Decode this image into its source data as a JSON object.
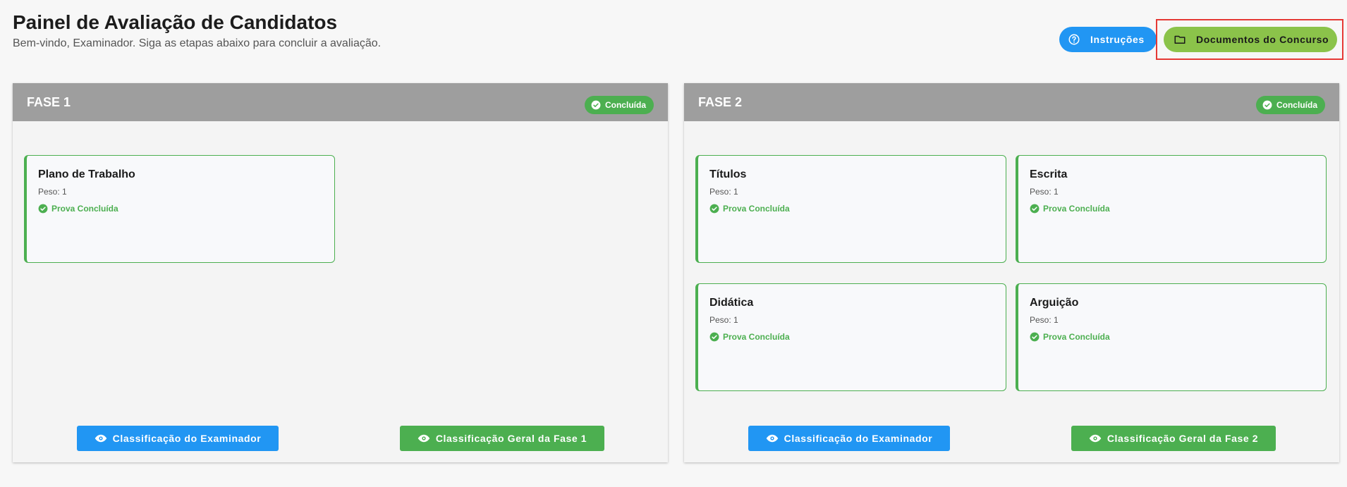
{
  "header": {
    "title": "Painel de Avaliação de Candidatos",
    "subtitle": "Bem-vindo, Examinador. Siga as etapas abaixo para concluir a avaliação."
  },
  "top_buttons": {
    "instructions_label": "Instruções",
    "documents_label": "Documentos do Concurso"
  },
  "phases": [
    {
      "title": "FASE 1",
      "status": "Concluída",
      "cards": [
        {
          "name": "Plano de Trabalho",
          "peso": "Peso: 1",
          "status": "Prova Concluída"
        }
      ],
      "examiner_button": "Classificação do Examinador",
      "general_button": "Classificação Geral da Fase 1"
    },
    {
      "title": "FASE 2",
      "status": "Concluída",
      "cards": [
        {
          "name": "Títulos",
          "peso": "Peso: 1",
          "status": "Prova Concluída"
        },
        {
          "name": "Escrita",
          "peso": "Peso: 1",
          "status": "Prova Concluída"
        },
        {
          "name": "Didática",
          "peso": "Peso: 1",
          "status": "Prova Concluída"
        },
        {
          "name": "Arguição",
          "peso": "Peso: 1",
          "status": "Prova Concluída"
        }
      ],
      "examiner_button": "Classificação do Examinador",
      "general_button": "Classificação Geral da Fase 2"
    }
  ],
  "icons": {
    "instructions": "question-circle-icon",
    "documents": "folder-icon",
    "status": "check-circle-icon",
    "view": "eye-icon"
  },
  "colors": {
    "primary_blue": "#2196f3",
    "success_green": "#4caf50",
    "docs_green": "#8bc34a",
    "phase_header": "#9e9e9e",
    "highlight_outline": "#e53935"
  }
}
